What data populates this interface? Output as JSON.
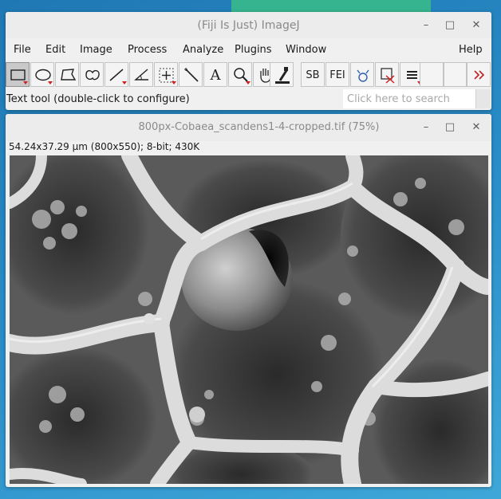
{
  "main_window": {
    "title": "(Fiji Is Just) ImageJ",
    "controls": {
      "minimize": "–",
      "maximize": "□",
      "close": "✕"
    },
    "menu": [
      "File",
      "Edit",
      "Image",
      "Process",
      "Analyze",
      "Plugins",
      "Window",
      "Help"
    ],
    "tools": [
      {
        "name": "rectangle-tool",
        "icon": "rectangle-icon",
        "selected": true,
        "has_menu": true
      },
      {
        "name": "oval-tool",
        "icon": "oval-icon",
        "has_menu": true
      },
      {
        "name": "polygon-tool",
        "icon": "polygon-icon"
      },
      {
        "name": "freehand-tool",
        "icon": "freehand-icon"
      },
      {
        "name": "line-tool",
        "icon": "line-icon",
        "has_menu": true
      },
      {
        "name": "angle-tool",
        "icon": "angle-icon"
      },
      {
        "name": "point-tool",
        "icon": "point-icon",
        "has_menu": true
      },
      {
        "name": "wand-tool",
        "icon": "wand-icon"
      },
      {
        "name": "text-tool",
        "label": "A"
      },
      {
        "name": "magnifier-tool",
        "icon": "magnifier-icon",
        "has_menu": true
      },
      {
        "name": "scrolling-tool",
        "icon": "hand-icon"
      },
      {
        "name": "color-picker-tool",
        "icon": "dropper-icon"
      },
      {
        "name": "scalebar-tool",
        "label": "SB"
      },
      {
        "name": "fei-tool",
        "label": "FEI"
      },
      {
        "name": "stacker-tool",
        "icon": "stacker-icon"
      },
      {
        "name": "roi-tool",
        "icon": "roi-cross-icon"
      },
      {
        "name": "menu-tool",
        "icon": "hamburger-icon",
        "has_menu": true
      },
      {
        "name": "blank-tool-1"
      },
      {
        "name": "blank-tool-2"
      },
      {
        "name": "more-tools",
        "icon": "double-chevron-icon"
      }
    ],
    "status_text": "Text tool (double-click to configure)",
    "search_placeholder": "Click here to search"
  },
  "image_window": {
    "title": "800px-Cobaea_scandens1-4-cropped.tif (75%)",
    "controls": {
      "minimize": "–",
      "maximize": "□",
      "close": "✕"
    },
    "info": "54.24x37.29 µm (800x550); 8-bit; 430K"
  },
  "colors": {
    "desktop": "#2b8fc9",
    "window_bg": "#f0f0f0",
    "title_text": "#8a8a8a",
    "tool_menu_marker": "#d02020"
  }
}
